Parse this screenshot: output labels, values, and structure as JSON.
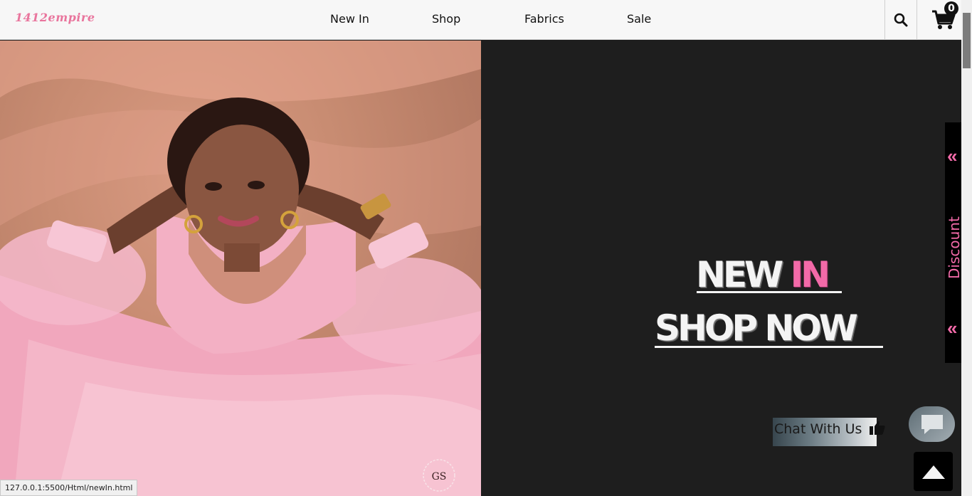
{
  "header": {
    "logo": "1412empire",
    "nav": [
      {
        "label": "New In"
      },
      {
        "label": "Shop"
      },
      {
        "label": "Fabrics"
      },
      {
        "label": "Sale"
      }
    ],
    "cart_count": "0",
    "search_icon": "search-icon",
    "cart_icon": "cart-icon"
  },
  "hero": {
    "line1_white": "NEW",
    "line1_pink": "IN",
    "line2": "SHOP NOW",
    "photo_watermark": "GS"
  },
  "side_tab": {
    "label": "Discount",
    "chevron_top": "«",
    "chevron_bottom": "«"
  },
  "chat": {
    "label": "Chat With Us",
    "thumb_icon": "thumbs-up-icon",
    "bubble_icon": "chat-bubble-icon"
  },
  "back_to_top_icon": "caret-up-icon",
  "status_bar": {
    "url": "127.0.0.1:5500/Html/newIn.html"
  },
  "colors": {
    "accent_pink": "#f26aa8",
    "logo_pink": "#e9759d",
    "dark_bg": "#1e1e1e",
    "header_bg": "#f7f7f7"
  }
}
